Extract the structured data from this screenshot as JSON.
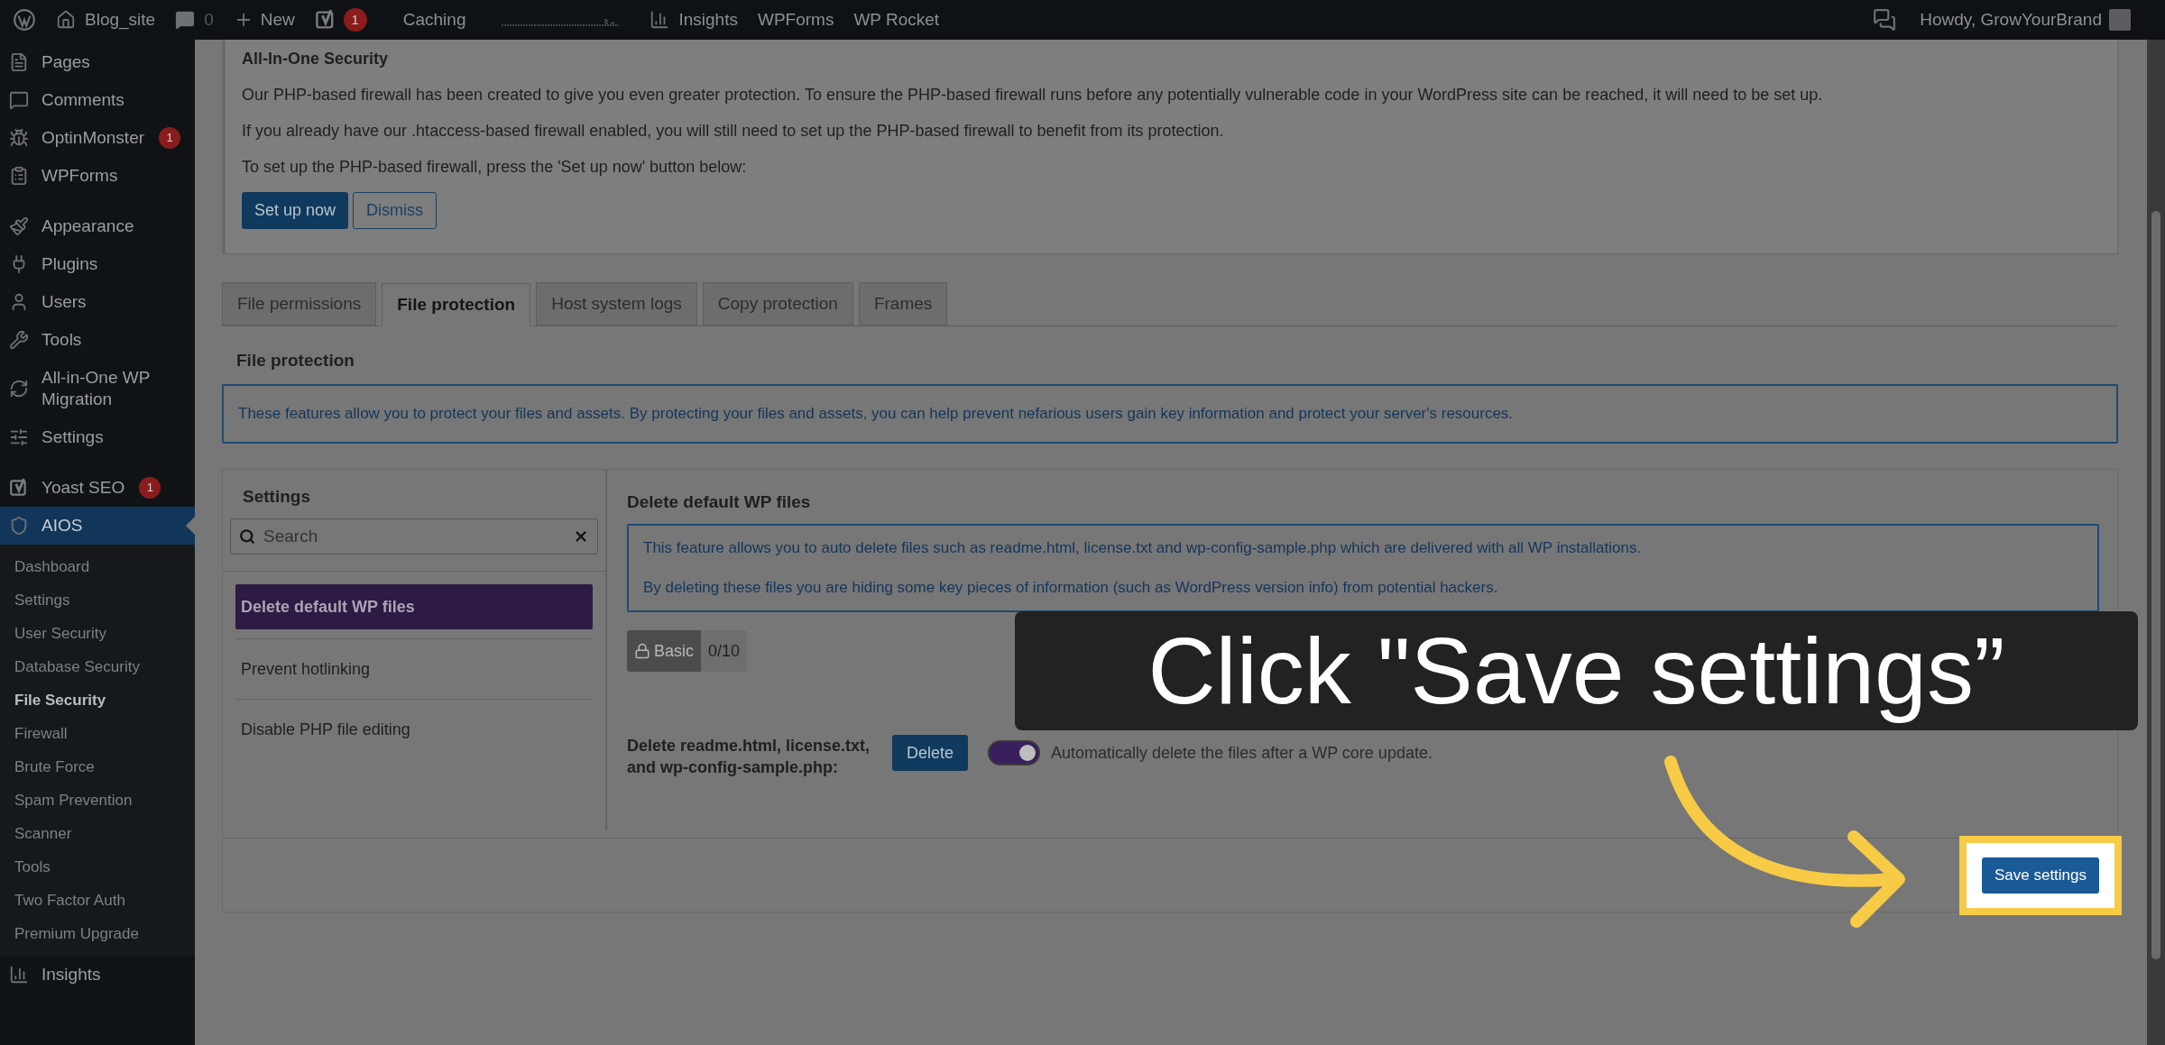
{
  "top_bar": {
    "site": "Blog_site",
    "comments": "0",
    "new": "New",
    "yoast_count": "1",
    "caching": "Caching",
    "insights": "Insights",
    "wpforms": "WPForms",
    "wprocket": "WP Rocket",
    "greeting": "Howdy, GrowYourBrand"
  },
  "sidebar": {
    "groups": [
      [
        {
          "label": "Pages",
          "selected": false
        },
        {
          "label": "Comments",
          "selected": false
        },
        {
          "label": "OptinMonster",
          "badge": "1",
          "selected": false
        },
        {
          "label": "WPForms",
          "selected": false
        }
      ],
      [
        {
          "label": "Appearance",
          "selected": false
        },
        {
          "label": "Plugins",
          "selected": false
        },
        {
          "label": "Users",
          "selected": false
        },
        {
          "label": "Tools",
          "selected": false
        },
        {
          "label": "All-in-One WP Migration",
          "selected": false
        },
        {
          "label": "Settings",
          "selected": false
        }
      ],
      [
        {
          "label": "Yoast SEO",
          "badge": "1",
          "selected": false
        },
        {
          "label": "AIOS",
          "selected": true,
          "children": [
            {
              "label": "Dashboard",
              "selected": false
            },
            {
              "label": "Settings",
              "selected": false
            },
            {
              "label": "User Security",
              "selected": false
            },
            {
              "label": "Database Security",
              "selected": false
            },
            {
              "label": "File Security",
              "selected": true
            },
            {
              "label": "Firewall",
              "selected": false
            },
            {
              "label": "Brute Force",
              "selected": false
            },
            {
              "label": "Spam Prevention",
              "selected": false
            },
            {
              "label": "Scanner",
              "selected": false
            },
            {
              "label": "Tools",
              "selected": false
            },
            {
              "label": "Two Factor Auth",
              "selected": false
            },
            {
              "label": "Premium Upgrade",
              "selected": false
            }
          ]
        },
        {
          "label": "Insights",
          "selected": false
        }
      ]
    ]
  },
  "notice": {
    "title": "All-In-One Security",
    "paragraphs": [
      "Our PHP-based firewall has been created to give you even greater protection. To ensure the PHP-based firewall runs before any potentially vulnerable code in your WordPress site can be reached, it will need to be set up.",
      "If you already have our .htaccess-based firewall enabled, you will still need to set up the PHP-based firewall to benefit from its protection.",
      "To set up the PHP-based firewall, press the 'Set up now' button below:"
    ],
    "buttons": [
      {
        "label": "Set up now",
        "kind": "primary"
      },
      {
        "label": "Dismiss",
        "kind": "secondary"
      }
    ]
  },
  "tabs": [
    {
      "label": "File permissions",
      "selected": false
    },
    {
      "label": "File protection",
      "selected": true
    },
    {
      "label": "Host system logs",
      "selected": false
    },
    {
      "label": "Copy protection",
      "selected": false
    },
    {
      "label": "Frames",
      "selected": false
    }
  ],
  "section_title": "File protection",
  "section_info": "These features allow you to protect your files and assets. By protecting your files and assets, you can help prevent nefarious users gain key information and protect your server's resources.",
  "settings_panel": {
    "heading": "Settings",
    "search": {
      "placeholder": "Search"
    },
    "items": [
      {
        "label": "Delete default WP files",
        "selected": true
      },
      {
        "label": "Prevent hotlinking",
        "selected": false
      },
      {
        "label": "Disable PHP file editing",
        "selected": false
      }
    ]
  },
  "feature": {
    "title": "Delete default WP files",
    "info": [
      "This feature allows you to auto delete files such as readme.html, license.txt and wp-config-sample.php which are delivered with all WP installations.",
      "By deleting these files you are hiding some key pieces of information (such as WordPress version info) from potential hackers."
    ],
    "level_badge": "Basic",
    "score": "0/10",
    "row_label": "Delete readme.html, license.txt, and wp-config-sample.php:",
    "delete_button": "Delete",
    "toggle": {
      "on": true,
      "label": "Automatically delete the files after a WP core update."
    }
  },
  "save_button": "Save settings",
  "callout": "Click \"Save settings”"
}
